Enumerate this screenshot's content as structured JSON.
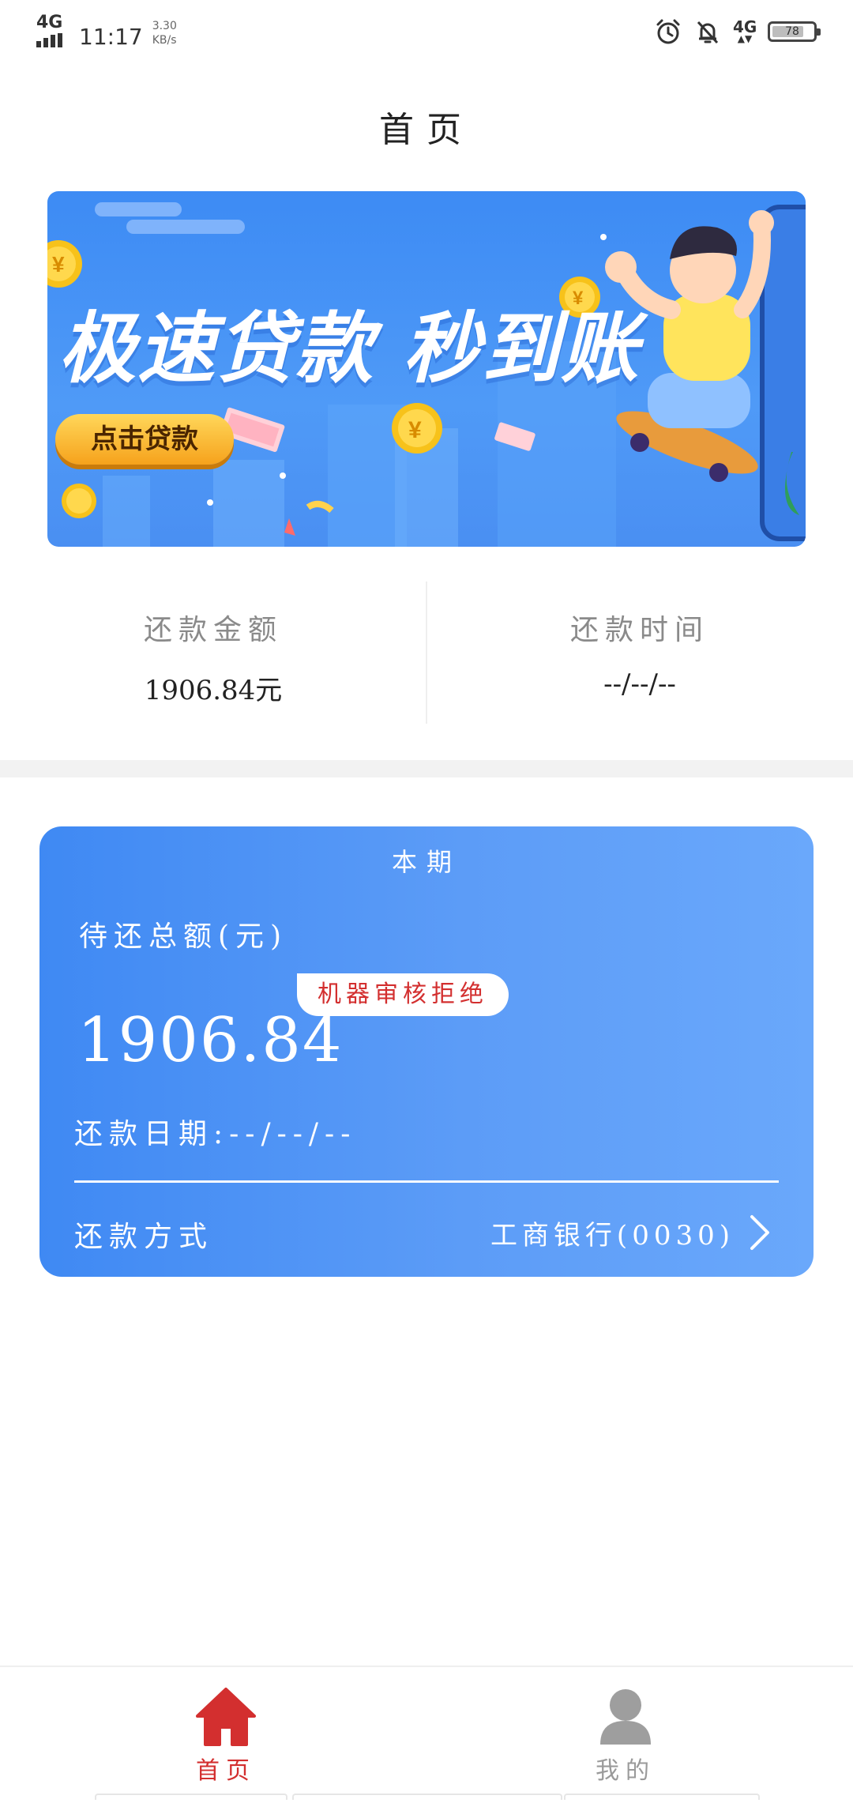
{
  "status_bar": {
    "network": "4G",
    "time": "11:17",
    "speed_value": "3.30",
    "speed_unit": "KB/s",
    "network_right": "4G",
    "battery_level": "78",
    "icons": [
      "alarm-icon",
      "notifications-off-icon",
      "signal-4g-icon",
      "battery-icon"
    ]
  },
  "header": {
    "title": "首页"
  },
  "banner": {
    "headline": "极速贷款 秒到账",
    "button_label": "点击贷款",
    "colors": {
      "background": "#4a94f5",
      "button": "#f8b42c"
    }
  },
  "summary": {
    "left": {
      "label": "还款金额",
      "value": "1906.84元"
    },
    "right": {
      "label": "还款时间",
      "value": "--/--/--"
    }
  },
  "card": {
    "period_label": "本期",
    "total_label": "待还总额(元)",
    "badge": "机器审核拒绝",
    "amount": "1906.84",
    "date_text": "还款日期:--/--/--",
    "method_label": "还款方式",
    "method_value": "工商银行(0030)",
    "colors": {
      "start": "#3f89f3",
      "end": "#6aa8fb",
      "badge_text": "#d32f2f"
    }
  },
  "bottom_nav": {
    "items": [
      {
        "label": "首页",
        "icon": "home-icon",
        "active": true
      },
      {
        "label": "我的",
        "icon": "user-icon",
        "active": false
      }
    ],
    "colors": {
      "active": "#d32f2f",
      "inactive": "#9a9a9a"
    }
  }
}
